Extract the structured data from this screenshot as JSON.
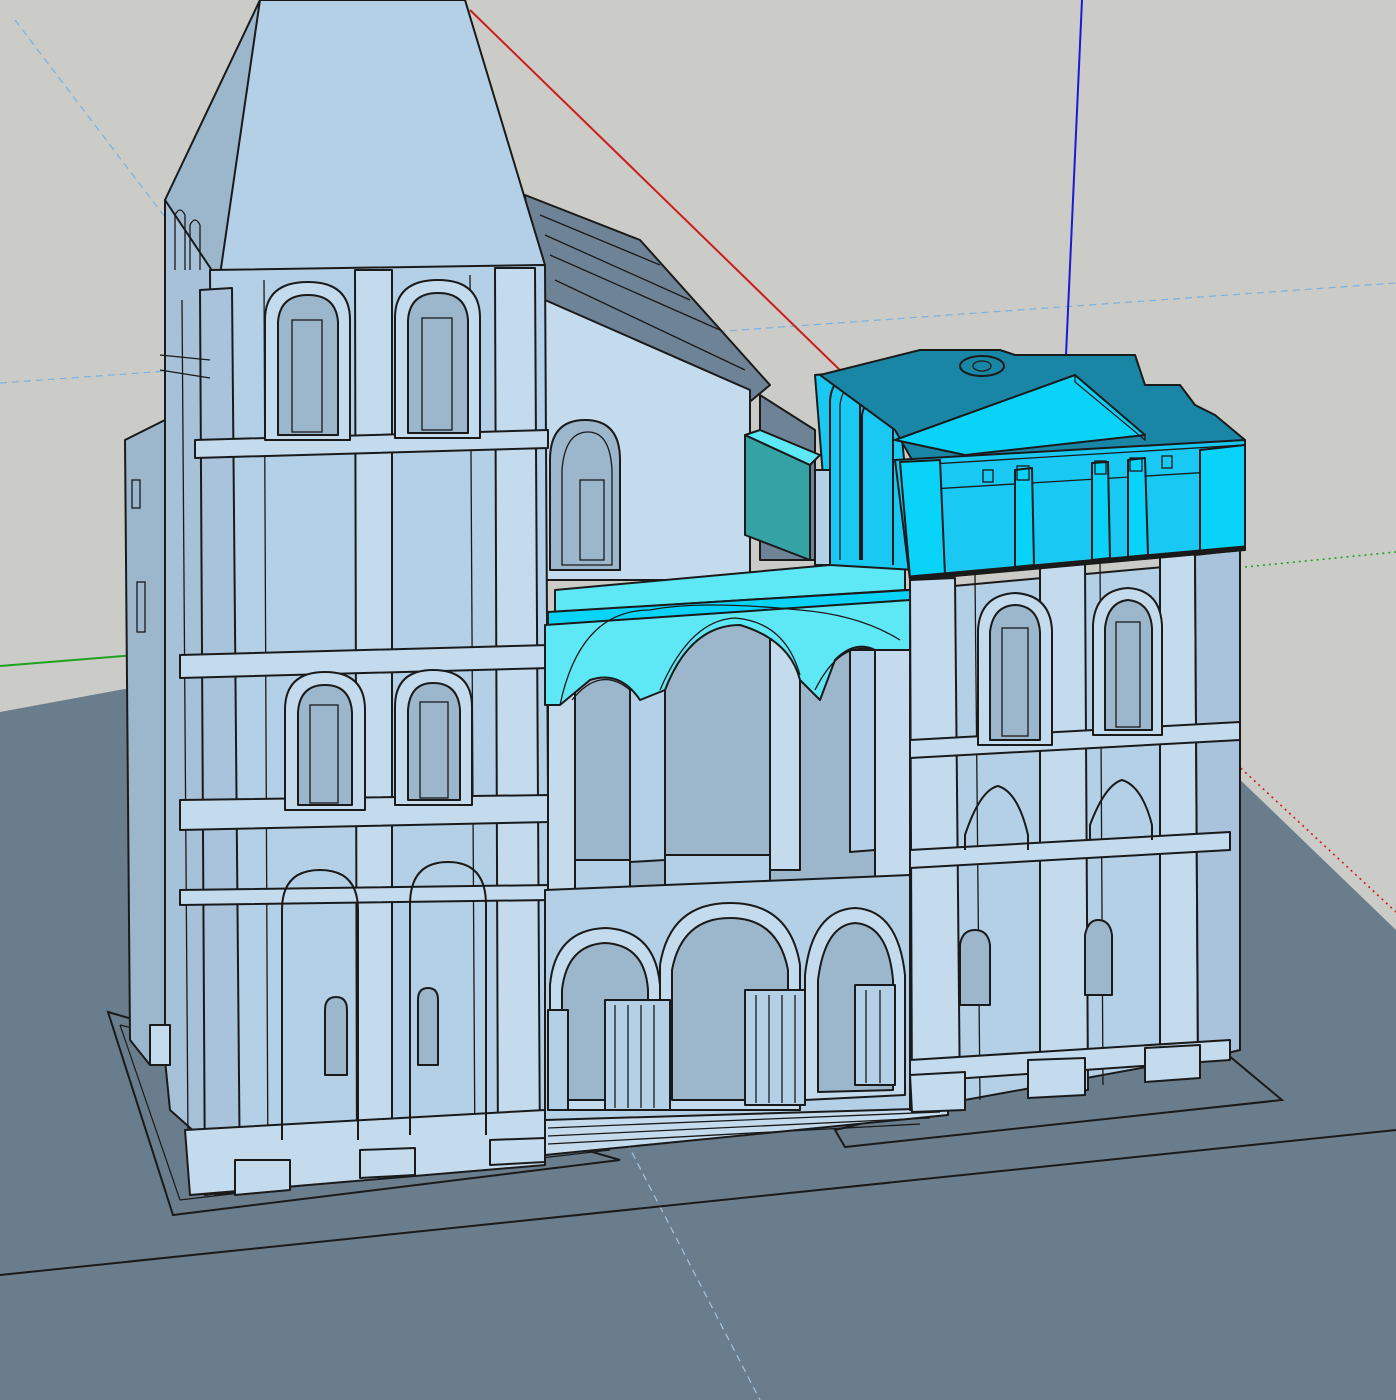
{
  "app": {
    "name": ""
  },
  "scene": {
    "colors": {
      "sky": "#cbcbc7",
      "ground": "#6a7d8d",
      "face_front": "#b4d0e6",
      "face_side": "#9cb6cc",
      "face_light": "#c4dbee",
      "roof_dark": "#6e8396",
      "selected_front": "#19c9f3",
      "selected_top": "#0ad3f9",
      "selected_dark": "#1a86a6",
      "selected_bridge": "#5ee7f5",
      "selected_gallery_side": "#35a3a5",
      "axis_red": "#cc1d1d",
      "axis_green": "#1fa31f",
      "axis_blue": "#1b1bd0",
      "guide_blue": "#7bb2e0",
      "edge": "#1a1a1a"
    },
    "selection": {
      "selected_components": [
        "right-tower-top",
        "upper-gallery-bridge",
        "gallery-side-wall"
      ]
    }
  }
}
